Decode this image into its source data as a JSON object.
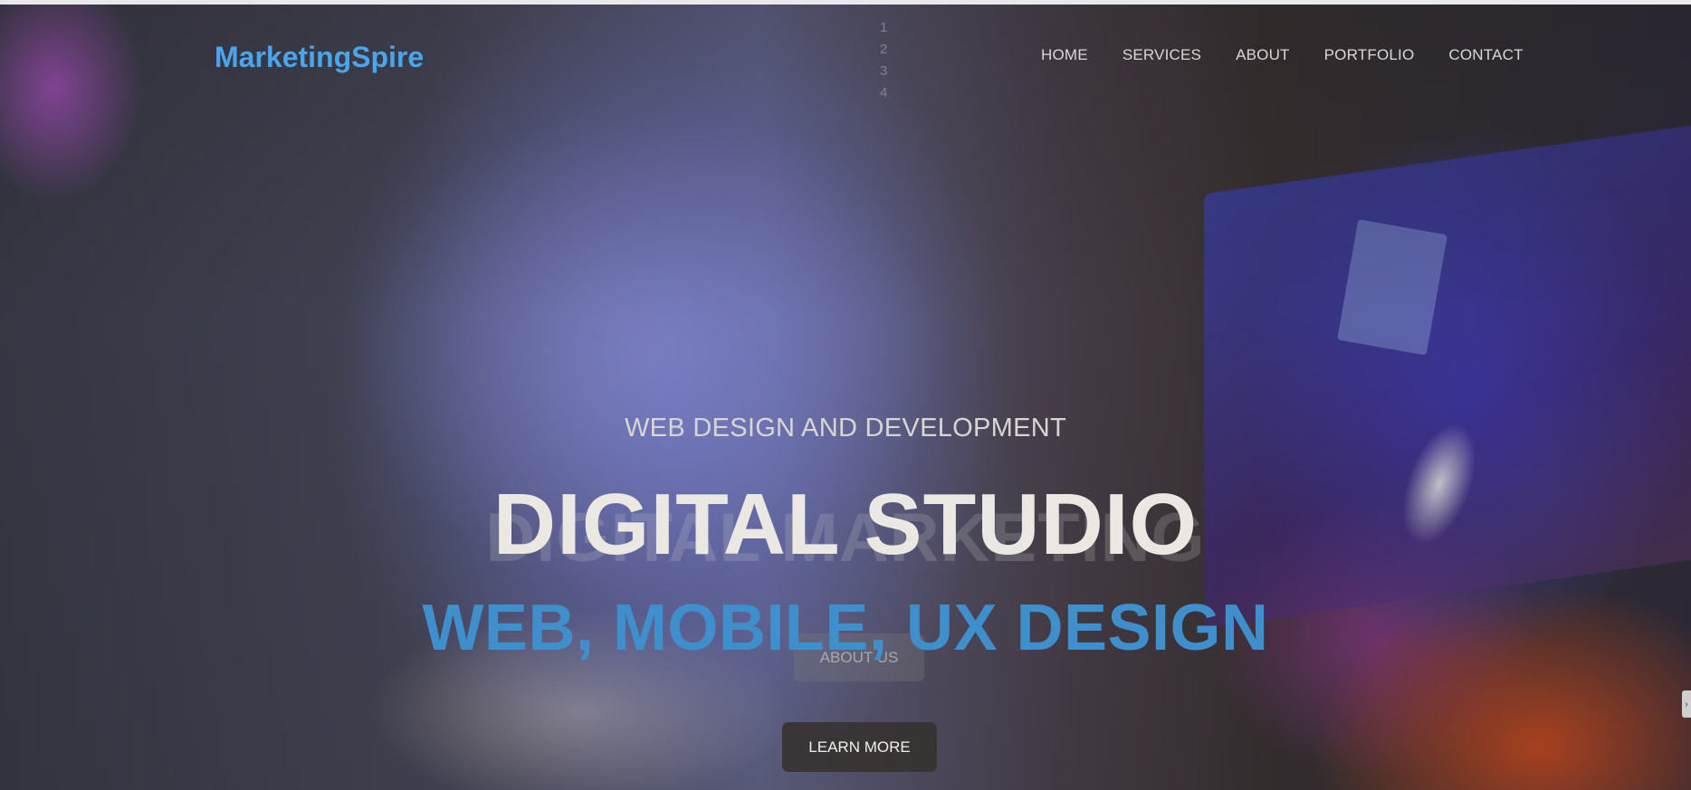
{
  "brand": {
    "logo_text": "MarketingSpire",
    "accent": "#4aa6ec"
  },
  "nav": {
    "items": [
      {
        "label": "HOME"
      },
      {
        "label": "SERVICES"
      },
      {
        "label": "ABOUT"
      },
      {
        "label": "PORTFOLIO"
      },
      {
        "label": "CONTACT"
      }
    ]
  },
  "slider": {
    "indicators": [
      "1",
      "2",
      "3",
      "4"
    ]
  },
  "hero": {
    "subtitle": "WEB DESIGN AND DEVELOPMENT",
    "title": "DIGITAL STUDIO",
    "ghost_title": "DIGITAL MARKETING",
    "tagline": "WEB, MOBILE, UX DESIGN",
    "tagline_color": "#3f8fcd",
    "ghost_button_label": "ABOUT US",
    "cta_label": "LEARN MORE"
  },
  "side_tab": {
    "icon": "chevron-right-icon",
    "glyph": "›"
  }
}
